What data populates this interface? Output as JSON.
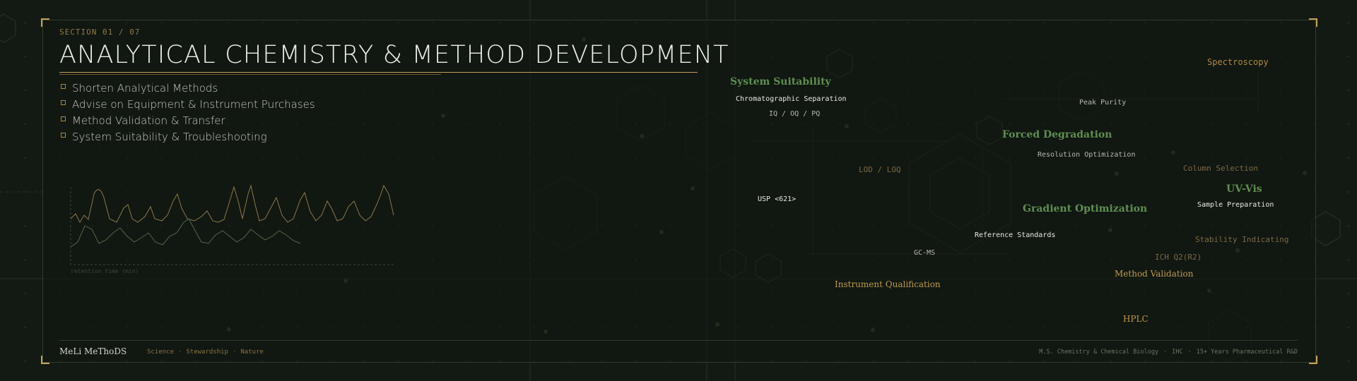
{
  "header": {
    "section_label": "SECTION 01 / 07",
    "title": "ANALYTICAL CHEMISTRY & METHOD DEVELOPMENT"
  },
  "bullets": [
    "Shorten Analytical Methods",
    "Advise on Equipment & Instrument Purchases",
    "Method Validation & Transfer",
    "System Suitability & Troubleshooting"
  ],
  "chromatogram": {
    "axis_label": "retention time (min)"
  },
  "terms": {
    "system_suitability": "System Suitability",
    "chromatographic_separation": "Chromatographic Separation",
    "iq_oq_pq": "IQ / OQ / PQ",
    "spectroscopy": "Spectroscopy",
    "peak_purity": "Peak Purity",
    "forced_degradation": "Forced Degradation",
    "resolution_optimization": "Resolution Optimization",
    "lod_loq": "LOD / LOQ",
    "column_selection": "Column Selection",
    "uv_vis": "UV-Vis",
    "sample_preparation": "Sample Preparation",
    "usp_621": "USP <621>",
    "gradient_optimization": "Gradient Optimization",
    "reference_standards": "Reference Standards",
    "stability_indicating": "Stability Indicating",
    "gc_ms": "GC-MS",
    "ich_q2r2": "ICH Q2(R2)",
    "method_validation": "Method Validation",
    "instrument_qualification": "Instrument Qualification",
    "hplc": "HPLC"
  },
  "footer": {
    "brand": "MeLi MeThoDS",
    "tagline": [
      "Science",
      "Stewardship",
      "Nature"
    ],
    "credentials": [
      "M.S. Chemistry & Chemical Biology",
      "IHC",
      "15+ Years Pharmaceutical R&D"
    ]
  },
  "colors": {
    "background": "#131a13",
    "accent_gold": "#c8a25a",
    "accent_green": "#5f8f52",
    "frame": "#2f3d2c"
  }
}
